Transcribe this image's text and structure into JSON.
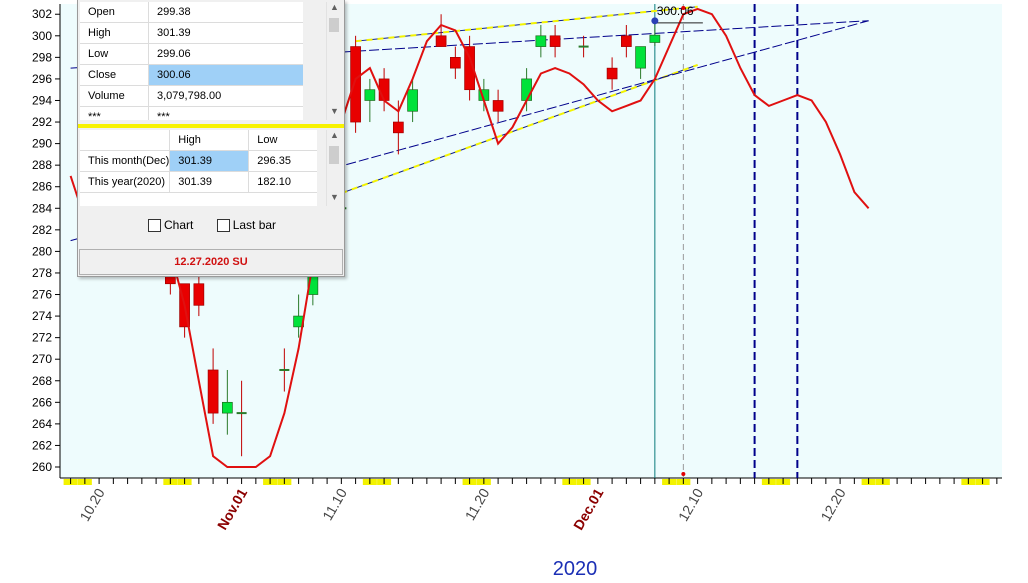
{
  "chart_data": {
    "type": "candlestick",
    "year_label": "2020",
    "y_ticks": [
      260,
      262,
      264,
      266,
      268,
      270,
      272,
      274,
      276,
      278,
      280,
      282,
      284,
      286,
      288,
      290,
      292,
      294,
      296,
      298,
      300,
      302
    ],
    "x_ticks": [
      {
        "label": "10.20",
        "idx": 2,
        "month": false
      },
      {
        "label": "Nov.01",
        "idx": 12,
        "month": true
      },
      {
        "label": "11.10",
        "idx": 19,
        "month": false
      },
      {
        "label": "11.20",
        "idx": 29,
        "month": false
      },
      {
        "label": "Dec.01",
        "idx": 37,
        "month": true
      },
      {
        "label": "12.10",
        "idx": 44,
        "month": false
      },
      {
        "label": "12.20",
        "idx": 54,
        "month": false
      }
    ],
    "candles": [
      {
        "idx": 7,
        "o": 279,
        "c": 277,
        "h": 281,
        "l": 276
      },
      {
        "idx": 8,
        "o": 277,
        "c": 273,
        "h": 277,
        "l": 272
      },
      {
        "idx": 9,
        "o": 277,
        "c": 275,
        "h": 278,
        "l": 274
      },
      {
        "idx": 10,
        "o": 269,
        "c": 265,
        "h": 271,
        "l": 264
      },
      {
        "idx": 11,
        "o": 265,
        "c": 266,
        "h": 269,
        "l": 263
      },
      {
        "idx": 12,
        "o": 265,
        "c": 265,
        "h": 268,
        "l": 261
      },
      {
        "idx": 15,
        "o": 269,
        "c": 269,
        "h": 271,
        "l": 267
      },
      {
        "idx": 16,
        "o": 273,
        "c": 274,
        "h": 276,
        "l": 272
      },
      {
        "idx": 17,
        "o": 276,
        "c": 278,
        "h": 282,
        "l": 275
      },
      {
        "idx": 19,
        "o": 284,
        "c": 284,
        "h": 285,
        "l": 282
      },
      {
        "idx": 20,
        "o": 299,
        "c": 292,
        "h": 300,
        "l": 291
      },
      {
        "idx": 21,
        "o": 294,
        "c": 295,
        "h": 296,
        "l": 292
      },
      {
        "idx": 22,
        "o": 296,
        "c": 294,
        "h": 297,
        "l": 293
      },
      {
        "idx": 23,
        "o": 292,
        "c": 291,
        "h": 294,
        "l": 289
      },
      {
        "idx": 24,
        "o": 293,
        "c": 295,
        "h": 296,
        "l": 292
      },
      {
        "idx": 26,
        "o": 300,
        "c": 299,
        "h": 302,
        "l": 299
      },
      {
        "idx": 27,
        "o": 298,
        "c": 297,
        "h": 299,
        "l": 296
      },
      {
        "idx": 28,
        "o": 299,
        "c": 295,
        "h": 300,
        "l": 294
      },
      {
        "idx": 29,
        "o": 294,
        "c": 295,
        "h": 296,
        "l": 293
      },
      {
        "idx": 30,
        "o": 294,
        "c": 293,
        "h": 295,
        "l": 292
      },
      {
        "idx": 32,
        "o": 294,
        "c": 296,
        "h": 297,
        "l": 293
      },
      {
        "idx": 33,
        "o": 299,
        "c": 300,
        "h": 301,
        "l": 298
      },
      {
        "idx": 34,
        "o": 300,
        "c": 299,
        "h": 301,
        "l": 298
      },
      {
        "idx": 36,
        "o": 299,
        "c": 299,
        "h": 300,
        "l": 298
      },
      {
        "idx": 38,
        "o": 297,
        "c": 296,
        "h": 298,
        "l": 295
      },
      {
        "idx": 39,
        "o": 300,
        "c": 299,
        "h": 301,
        "l": 298
      },
      {
        "idx": 40,
        "o": 297,
        "c": 299,
        "h": 299,
        "l": 296
      },
      {
        "idx": 41,
        "o": 299.38,
        "c": 300.06,
        "h": 301.39,
        "l": 299.06
      }
    ],
    "cycle_line": [
      {
        "idx": 0,
        "v": 287
      },
      {
        "idx": 1,
        "v": 283
      },
      {
        "idx": 3,
        "v": 284
      },
      {
        "idx": 5,
        "v": 286
      },
      {
        "idx": 6,
        "v": 284
      },
      {
        "idx": 7,
        "v": 280
      },
      {
        "idx": 8,
        "v": 275
      },
      {
        "idx": 9,
        "v": 268
      },
      {
        "idx": 10,
        "v": 261
      },
      {
        "idx": 11,
        "v": 260
      },
      {
        "idx": 12,
        "v": 260
      },
      {
        "idx": 13,
        "v": 260
      },
      {
        "idx": 14,
        "v": 261
      },
      {
        "idx": 15,
        "v": 265
      },
      {
        "idx": 16,
        "v": 271
      },
      {
        "idx": 17,
        "v": 279
      },
      {
        "idx": 18,
        "v": 285
      },
      {
        "idx": 19,
        "v": 292
      },
      {
        "idx": 20,
        "v": 296
      },
      {
        "idx": 21,
        "v": 297
      },
      {
        "idx": 22,
        "v": 294
      },
      {
        "idx": 23,
        "v": 293
      },
      {
        "idx": 24,
        "v": 296
      },
      {
        "idx": 25,
        "v": 299.5
      },
      {
        "idx": 26,
        "v": 301
      },
      {
        "idx": 27,
        "v": 300.5
      },
      {
        "idx": 28,
        "v": 298
      },
      {
        "idx": 29,
        "v": 294
      },
      {
        "idx": 30,
        "v": 290
      },
      {
        "idx": 31,
        "v": 291.5
      },
      {
        "idx": 32,
        "v": 294
      },
      {
        "idx": 33,
        "v": 296.5
      },
      {
        "idx": 34,
        "v": 297
      },
      {
        "idx": 35,
        "v": 296.5
      },
      {
        "idx": 36,
        "v": 295.5
      },
      {
        "idx": 37,
        "v": 294
      },
      {
        "idx": 38,
        "v": 293
      },
      {
        "idx": 39,
        "v": 293.5
      },
      {
        "idx": 40,
        "v": 294
      },
      {
        "idx": 41,
        "v": 296
      },
      {
        "idx": 42,
        "v": 299
      },
      {
        "idx": 43,
        "v": 302
      },
      {
        "idx": 44,
        "v": 302.5
      },
      {
        "idx": 45,
        "v": 302
      },
      {
        "idx": 46,
        "v": 300
      },
      {
        "idx": 47,
        "v": 297
      },
      {
        "idx": 48,
        "v": 294.5
      },
      {
        "idx": 49,
        "v": 293.5
      },
      {
        "idx": 50,
        "v": 294
      },
      {
        "idx": 51,
        "v": 294.5
      },
      {
        "idx": 52,
        "v": 294
      },
      {
        "idx": 53,
        "v": 292
      },
      {
        "idx": 54,
        "v": 289
      },
      {
        "idx": 55,
        "v": 285.5
      },
      {
        "idx": 56,
        "v": 284
      }
    ],
    "trendlines": [
      {
        "kind": "upper-yellow",
        "from": {
          "idx": 20,
          "v": 299.5
        },
        "to": {
          "idx": 44,
          "v": 302.7
        }
      },
      {
        "kind": "lower-yellow",
        "from": {
          "idx": 19,
          "v": 285.4
        },
        "to": {
          "idx": 44,
          "v": 297.3
        }
      },
      {
        "kind": "upper-blue",
        "from": {
          "idx": 0,
          "v": 297
        },
        "to": {
          "idx": 56,
          "v": 301.4
        }
      },
      {
        "kind": "lower-blue",
        "from": {
          "idx": 0,
          "v": 281
        },
        "to": {
          "idx": 56,
          "v": 301.4
        }
      }
    ],
    "current_label": "300.06",
    "current_idx": 41,
    "vlines_blue": [
      48,
      51
    ],
    "vline_forecast": 43,
    "colors": {
      "up": "#00e23a",
      "down": "#e80000",
      "cycle": "#e01010",
      "plot_bg": "#eefcfd",
      "blue": "#00008b",
      "yellow": "#f3f300"
    }
  },
  "panel": {
    "quote_rows": [
      {
        "label": "Open",
        "value": "299.38",
        "selected": false
      },
      {
        "label": "High",
        "value": "301.39",
        "selected": false
      },
      {
        "label": "Low",
        "value": "299.06",
        "selected": false
      },
      {
        "label": "Close",
        "value": "300.06",
        "selected": true
      },
      {
        "label": "Volume",
        "value": "3,079,798.00",
        "selected": false
      },
      {
        "label": "***",
        "value": "***",
        "selected": false
      }
    ],
    "range_header": {
      "col1": "High",
      "col2": "Low"
    },
    "range_rows": [
      {
        "label": "This month(Dec)",
        "high": "301.39",
        "low": "296.35"
      },
      {
        "label": "This year(2020)",
        "high": "301.39",
        "low": "182.10"
      }
    ],
    "chart_checkbox_label": "Chart",
    "lastbar_checkbox_label": "Last bar",
    "date_label": "12.27.2020 SU"
  }
}
